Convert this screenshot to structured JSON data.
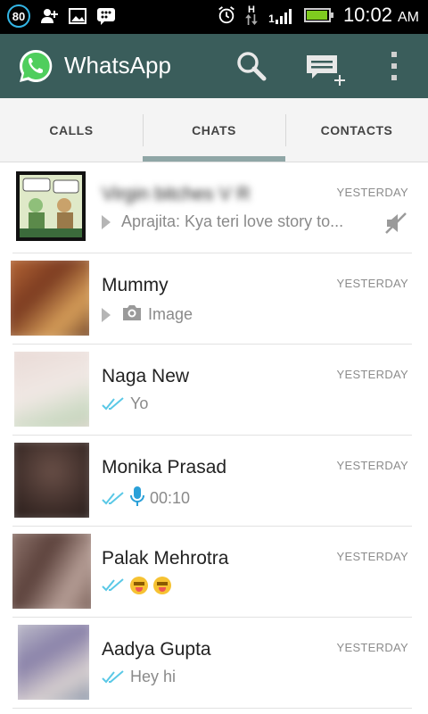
{
  "status_bar": {
    "notification_count": "80",
    "time": "10:02",
    "ampm": "AM",
    "network_type": "H",
    "signal_label": "1",
    "battery_level": 0.95
  },
  "app": {
    "title": "WhatsApp",
    "brand_color": "#3a5d5b"
  },
  "tabs": [
    {
      "label": "CALLS",
      "active": false
    },
    {
      "label": "CHATS",
      "active": true
    },
    {
      "label": "CONTACTS",
      "active": false
    }
  ],
  "chats": [
    {
      "name": "Virgin bitches V R",
      "time": "YESTERDAY",
      "preview": "Aprajita: Kya teri love story to...",
      "muted": true,
      "name_blurred": true
    },
    {
      "name": "Mummy",
      "time": "YESTERDAY",
      "preview": "Image",
      "preview_icon": "camera-icon"
    },
    {
      "name": "Naga New",
      "time": "YESTERDAY",
      "preview": "Yo",
      "read_ticks": true
    },
    {
      "name": "Monika Prasad",
      "time": "YESTERDAY",
      "preview": "00:10",
      "read_ticks": true,
      "preview_icon": "mic-icon"
    },
    {
      "name": "Palak Mehrotra",
      "time": "YESTERDAY",
      "preview": "",
      "read_ticks": true,
      "preview_icon": "emoji-icon"
    },
    {
      "name": "Aadya Gupta",
      "time": "YESTERDAY",
      "preview": "Hey hi",
      "read_ticks": true
    }
  ],
  "colors": {
    "tick_blue": "#5ac8e6",
    "status_blue": "#33b5e5"
  }
}
